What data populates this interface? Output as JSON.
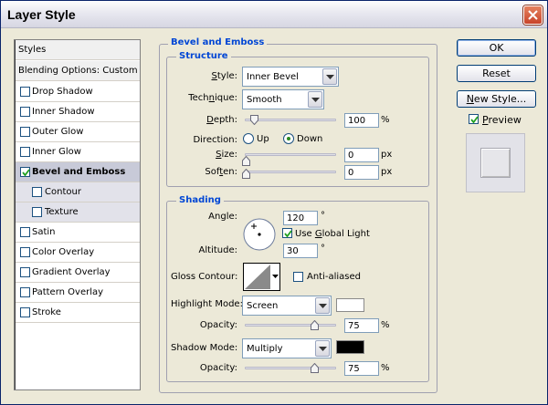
{
  "window": {
    "title": "Layer Style"
  },
  "style_list": {
    "header": "Styles",
    "blending": "Blending Options: Custom",
    "items": [
      {
        "label": "Drop Shadow",
        "checked": false
      },
      {
        "label": "Inner Shadow",
        "checked": false
      },
      {
        "label": "Outer Glow",
        "checked": false
      },
      {
        "label": "Inner Glow",
        "checked": false
      },
      {
        "label": "Bevel and Emboss",
        "checked": true,
        "selected": true
      },
      {
        "label": "Contour",
        "checked": false,
        "sub": true
      },
      {
        "label": "Texture",
        "checked": false,
        "sub": true
      },
      {
        "label": "Satin",
        "checked": false
      },
      {
        "label": "Color Overlay",
        "checked": false
      },
      {
        "label": "Gradient Overlay",
        "checked": false
      },
      {
        "label": "Pattern Overlay",
        "checked": false
      },
      {
        "label": "Stroke",
        "checked": false
      }
    ]
  },
  "bevel": {
    "title": "Bevel and Emboss",
    "structure": {
      "title": "Structure",
      "style_label_pre": "",
      "style_label_u": "S",
      "style_label_post": "tyle:",
      "style_value": "Inner Bevel",
      "technique_label_pre": "Tech",
      "technique_label_u": "n",
      "technique_label_post": "ique:",
      "technique_value": "Smooth",
      "depth_label_pre": "",
      "depth_label_u": "D",
      "depth_label_post": "epth:",
      "depth_value": "100",
      "depth_unit": "%",
      "direction_label": "Direction:",
      "dir_up": "Up",
      "dir_down": "Down",
      "size_label_pre": "",
      "size_label_u": "S",
      "size_label_post": "ize:",
      "size_value": "0",
      "size_unit": "px",
      "soften_label_pre": "Sof",
      "soften_label_u": "t",
      "soften_label_post": "en:",
      "soften_value": "0",
      "soften_unit": "px"
    },
    "shading": {
      "title": "Shading",
      "angle_label": "Angle:",
      "angle_value": "120",
      "angle_unit": "°",
      "global_light_pre": "Use ",
      "global_light_u": "G",
      "global_light_post": "lobal Light",
      "global_light_checked": true,
      "altitude_label": "Altitude:",
      "altitude_value": "30",
      "altitude_unit": "°",
      "gloss_label": "Gloss Contour:",
      "anti_aliased_label": "Anti-aliased",
      "anti_aliased_checked": false,
      "highlight_mode_label": "Highlight Mode:",
      "highlight_mode_value": "Screen",
      "highlight_color": "#ffffff",
      "highlight_opacity_label": "Opacity:",
      "highlight_opacity_value": "75",
      "highlight_opacity_unit": "%",
      "shadow_mode_label": "Shadow Mode:",
      "shadow_mode_value": "Multiply",
      "shadow_color": "#000000",
      "shadow_opacity_label": "Opacity:",
      "shadow_opacity_value": "75",
      "shadow_opacity_unit": "%"
    }
  },
  "buttons": {
    "ok": "OK",
    "reset": "Reset",
    "new_style_pre": "",
    "new_style_u": "N",
    "new_style_post": "ew Style...",
    "preview_pre": "",
    "preview_u": "P",
    "preview_post": "review",
    "preview_checked": true
  },
  "colors": {
    "accent": "#0046d5",
    "border": "#7f9db9"
  }
}
